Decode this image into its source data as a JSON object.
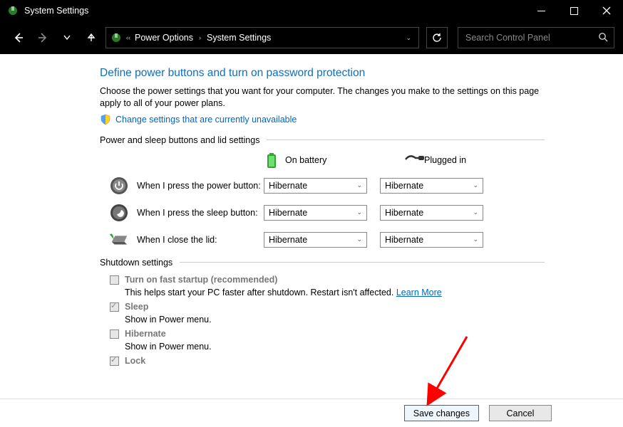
{
  "window": {
    "title": "System Settings"
  },
  "breadcrumb": {
    "level1": "Power Options",
    "level2": "System Settings"
  },
  "search": {
    "placeholder": "Search Control Panel"
  },
  "page": {
    "heading": "Define power buttons and turn on password protection",
    "description": "Choose the power settings that you want for your computer. The changes you make to the settings on this page apply to all of your power plans.",
    "change_link": "Change settings that are currently unavailable"
  },
  "power_section": {
    "title": "Power and sleep buttons and lid settings",
    "col_battery": "On battery",
    "col_plugged": "Plugged in",
    "rows": [
      {
        "label": "When I press the power button:",
        "battery": "Hibernate",
        "plugged": "Hibernate"
      },
      {
        "label": "When I press the sleep button:",
        "battery": "Hibernate",
        "plugged": "Hibernate"
      },
      {
        "label": "When I close the lid:",
        "battery": "Hibernate",
        "plugged": "Hibernate"
      }
    ]
  },
  "shutdown_section": {
    "title": "Shutdown settings",
    "fast_startup_label": "Turn on fast startup (recommended)",
    "fast_startup_desc": "This helps start your PC faster after shutdown. Restart isn't affected. ",
    "learn_more": "Learn More",
    "sleep_label": "Sleep",
    "sleep_desc": "Show in Power menu.",
    "hibernate_label": "Hibernate",
    "hibernate_desc": "Show in Power menu.",
    "lock_label": "Lock"
  },
  "footer": {
    "save": "Save changes",
    "cancel": "Cancel"
  }
}
